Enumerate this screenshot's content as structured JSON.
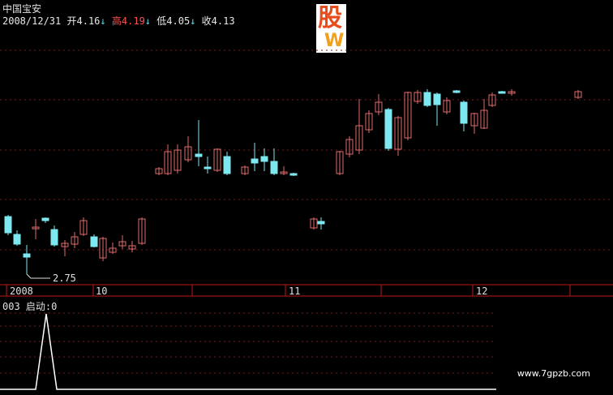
{
  "header": {
    "stock_name": "中国宝安",
    "date": "2008/12/31",
    "open_label": "开",
    "open_value": "4.16",
    "high_label": "高",
    "high_value": "4.19",
    "low_label": "低",
    "low_value": "4.05",
    "close_label": "收",
    "close_value": "4.13",
    "down_arrow": "↓"
  },
  "main_chart": {
    "low_annotation": "2.75",
    "x_labels": [
      "2008",
      "10",
      "11",
      "12"
    ]
  },
  "indicator": {
    "title": "003 启动:0"
  },
  "watermark": "www.7gpzb.com",
  "colors": {
    "bull": "#e06a6a",
    "bear": "#7de8f0",
    "grid": "#7a1a1a",
    "axis": "#c01818",
    "text": "#e0e0e0"
  },
  "chart_data": {
    "type": "candlestick",
    "candles": [
      {
        "o": 4.16,
        "c": 4.13,
        "h": 4.19,
        "l": 4.05
      }
    ],
    "indicator_series": {
      "name": "启动",
      "value": 0
    }
  }
}
